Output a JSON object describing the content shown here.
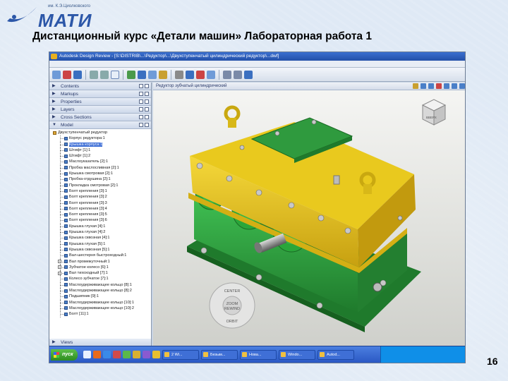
{
  "slide": {
    "logo_subtitle": "им. К.Э.Циолковского",
    "logo_text": "МАТИ",
    "title": "Дистанционный курс «Детали машин» Лабораторная работа 1",
    "number": "16"
  },
  "app": {
    "title": "Autodesk Design Review - [S:\\DISTRIB\\...\\Редуктор\\...\\Двухступенчатый цилиндрический редуктор\\...dwf]",
    "viewport_title": "Редуктор зубчатый цилиндрический"
  },
  "panel": {
    "headers": [
      "Contents",
      "Markups",
      "Properties",
      "Layers",
      "Cross Sections",
      "Model"
    ],
    "root": "Двухступенчатый редуктор",
    "items": [
      "Корпус редуктора:1",
      "Крышка корпуса:1",
      "Штифт [1]:1",
      "Штифт [1]:2",
      "Маслоуказатель [2]:1",
      "Пробка маслосливная [2]:1",
      "Крышка смотровая [2]:1",
      "Пробка-отдушина [2]:1",
      "Прокладка смотровая [2]:1",
      "Болт крепления [3]:1",
      "Болт крепления [3]:2",
      "Болт крепления [3]:3",
      "Болт крепления [3]:4",
      "Болт крепления [3]:5",
      "Болт крепления [3]:6",
      "Крышка глухая [4]:1",
      "Крышка глухая [4]:2",
      "Крышка сквозная [4]:1",
      "Крышка глухая [5]:1",
      "Крышка сквозная [5]:1",
      "Вал-шестерня быстроходный:1",
      "Вал промежуточный:1",
      "Зубчатое колесо [6]:1",
      "Вал тихоходный [7]:1",
      "Колесо зубчатое [7]:1",
      "Маслоудерживающее кольцо [8]:1",
      "Маслоудерживающее кольцо [8]:2",
      "Подшипник [9]:1",
      "Маслоудерживающее кольцо [10]:1",
      "Маслоудерживающее кольцо [10]:2",
      "Болт [11]:1"
    ],
    "views_label": "Views"
  },
  "nav_wheel": {
    "center": "CENTER",
    "zoom": "ZOOM",
    "rewind": "REWIND",
    "orbit": "ORBIT"
  },
  "viewcube": {
    "face": "ВВЕРХ"
  },
  "taskbar": {
    "start": "пуск",
    "tasks": [
      "2 Wi...",
      "Безым...",
      "Нова...",
      "Windo...",
      "Autod..."
    ]
  },
  "colors": {
    "housing_green": "#2f9a3e",
    "cover_yellow": "#e6c41c",
    "taskbar_blue": "#2b58c4"
  }
}
